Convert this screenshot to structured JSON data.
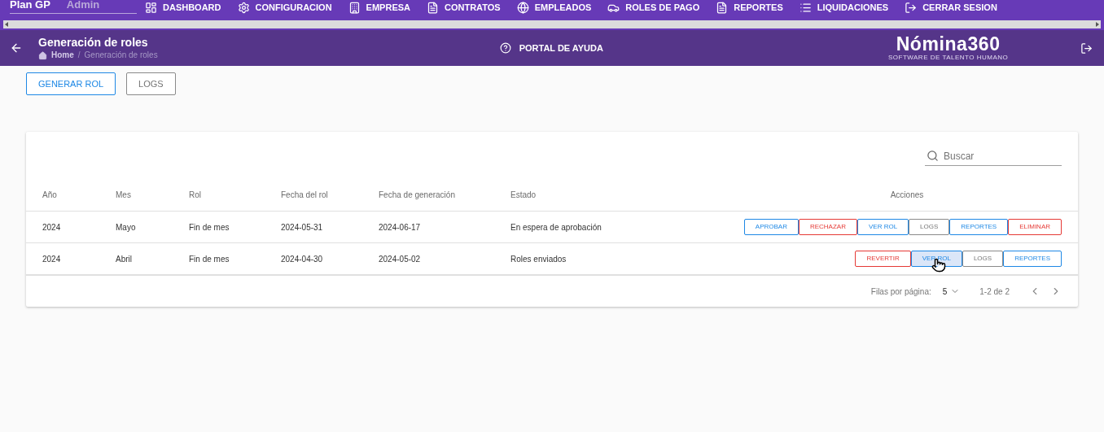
{
  "top_nav": {
    "user": {
      "plan": "Plan GP",
      "role": "Admin"
    },
    "items": [
      {
        "label": "DASHBOARD"
      },
      {
        "label": "CONFIGURACION"
      },
      {
        "label": "EMPRESA"
      },
      {
        "label": "CONTRATOS"
      },
      {
        "label": "EMPLEADOS"
      },
      {
        "label": "ROLES DE PAGO"
      },
      {
        "label": "REPORTES"
      },
      {
        "label": "LIQUIDACIONES"
      },
      {
        "label": "CERRAR SESION"
      }
    ]
  },
  "header": {
    "title": "Generación de roles",
    "breadcrumb": [
      {
        "label": "Home"
      },
      {
        "label": "Generación de roles"
      }
    ],
    "breadcrumb_separator": "/",
    "help": "PORTAL DE AYUDA",
    "logo": {
      "name": "Nómina360",
      "tagline": "SOFTWARE DE TALENTO HUMANO"
    }
  },
  "toolbar": [
    {
      "label": "GENERAR ROL",
      "kind": "primary"
    },
    {
      "label": "LOGS",
      "kind": "neutral"
    }
  ],
  "table": {
    "search": {
      "placeholder": "Buscar"
    },
    "columns": [
      "Año",
      "Mes",
      "Rol",
      "Fecha del rol",
      "Fecha de generación",
      "Estado",
      "Acciones"
    ],
    "rows": [
      {
        "cells": [
          "2024",
          "Mayo",
          "Fin de mes",
          "2024-05-31",
          "2024-06-17",
          "En espera de aprobación"
        ],
        "actions": [
          {
            "label": "APROBAR",
            "kind": "primary",
            "hovered": false
          },
          {
            "label": "RECHAZAR",
            "kind": "danger",
            "hovered": false
          },
          {
            "label": "VER ROL",
            "kind": "primary",
            "hovered": false
          },
          {
            "label": "LOGS",
            "kind": "neutral",
            "hovered": false
          },
          {
            "label": "REPORTES",
            "kind": "primary",
            "hovered": false
          },
          {
            "label": "ELIMINAR",
            "kind": "danger",
            "hovered": false
          }
        ]
      },
      {
        "cells": [
          "2024",
          "Abril",
          "Fin de mes",
          "2024-04-30",
          "2024-05-02",
          "Roles enviados"
        ],
        "actions": [
          {
            "label": "REVERTIR",
            "kind": "danger",
            "hovered": false
          },
          {
            "label": "VER ROL",
            "kind": "primary",
            "hovered": true
          },
          {
            "label": "LOGS",
            "kind": "neutral",
            "hovered": false
          },
          {
            "label": "REPORTES",
            "kind": "primary",
            "hovered": false
          }
        ]
      }
    ],
    "pagination": {
      "rows_label": "Filas por página:",
      "rows_per_page": "5",
      "range": "1-2 de 2"
    }
  }
}
